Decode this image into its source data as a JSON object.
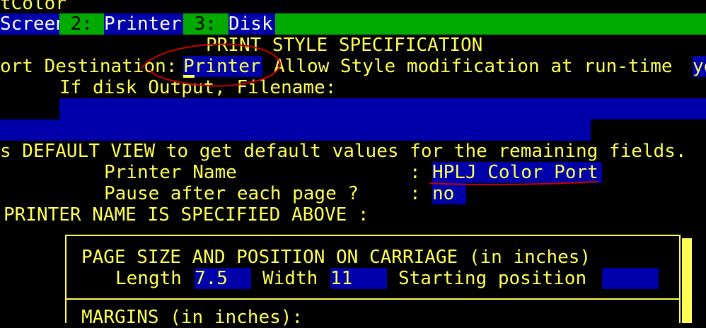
{
  "header": {
    "partial_title": "tColor"
  },
  "menu": {
    "items": [
      {
        "label": "Screen"
      },
      {
        "label": " 2: "
      },
      {
        "label": "Printer"
      },
      {
        "label": " 3: "
      },
      {
        "label": "Disk"
      }
    ]
  },
  "form": {
    "title": "PRINT STYLE SPECIFICATION",
    "report_destination_label": "ort Destination:",
    "report_destination_value": "Printer",
    "allow_style_label": "Allow Style modification at run-time",
    "allow_style_value": "ye",
    "disk_output_label": "If disk Output, Filename:",
    "default_view_hint": "s DEFAULT VIEW to get default values for the remaining fields.",
    "printer_name_label": "Printer Name",
    "printer_name_colon": ":",
    "printer_name_value": "HPLJ Color Port",
    "pause_label": "Pause after each page ?",
    "pause_colon": ":",
    "pause_value": "no",
    "printer_specified_note": "PRINTER NAME IS SPECIFIED ABOVE :",
    "page_size_heading": "PAGE SIZE AND POSITION ON CARRIAGE (in inches)",
    "length_label": "Length",
    "length_value": "7.5",
    "width_label": "Width",
    "width_value": "11",
    "starting_position_label": "Starting position",
    "starting_position_value": "",
    "margins_heading": "MARGINS (in inches):"
  },
  "colors": {
    "background": "#000000",
    "text": "#FFFF55",
    "field": "#0000AA",
    "menu_green": "#00AA00",
    "annotation": "#CC0000"
  }
}
